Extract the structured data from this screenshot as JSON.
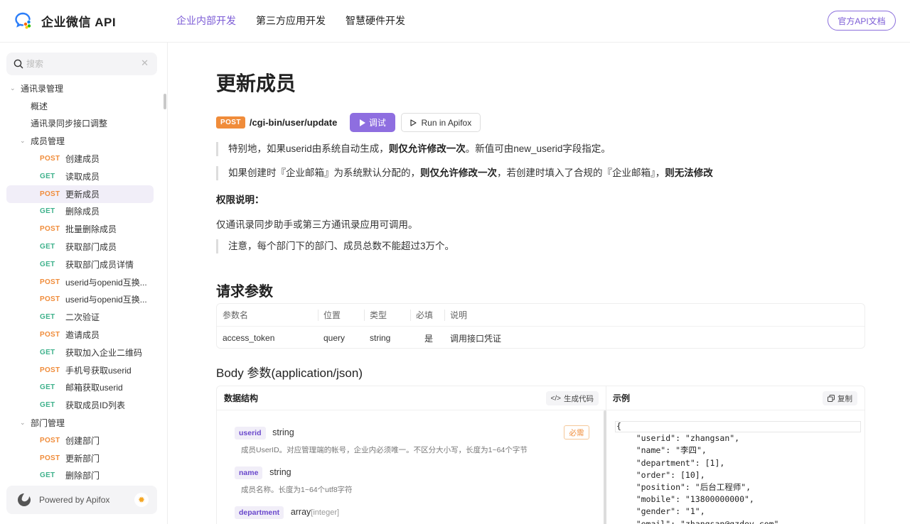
{
  "header": {
    "logo_text": "企业微信 API",
    "nav": [
      "企业内部开发",
      "第三方应用开发",
      "智慧硬件开发"
    ],
    "doc_button": "官方API文档"
  },
  "sidebar": {
    "search_placeholder": "搜索",
    "tree": [
      {
        "kind": "group",
        "label": "通讯录管理",
        "expanded": true
      },
      {
        "kind": "leaf",
        "label": "概述"
      },
      {
        "kind": "leaf",
        "label": "通讯录同步接口调整"
      },
      {
        "kind": "sub",
        "label": "成员管理",
        "expanded": true
      },
      {
        "kind": "api",
        "method": "POST",
        "label": "创建成员"
      },
      {
        "kind": "api",
        "method": "GET",
        "label": "读取成员"
      },
      {
        "kind": "api",
        "method": "POST",
        "label": "更新成员",
        "active": true
      },
      {
        "kind": "api",
        "method": "GET",
        "label": "删除成员"
      },
      {
        "kind": "api",
        "method": "POST",
        "label": "批量删除成员"
      },
      {
        "kind": "api",
        "method": "GET",
        "label": "获取部门成员"
      },
      {
        "kind": "api",
        "method": "GET",
        "label": "获取部门成员详情"
      },
      {
        "kind": "api",
        "method": "POST",
        "label": "userid与openid互换..."
      },
      {
        "kind": "api",
        "method": "POST",
        "label": "userid与openid互换..."
      },
      {
        "kind": "api",
        "method": "GET",
        "label": "二次验证"
      },
      {
        "kind": "api",
        "method": "POST",
        "label": "邀请成员"
      },
      {
        "kind": "api",
        "method": "GET",
        "label": "获取加入企业二维码"
      },
      {
        "kind": "api",
        "method": "POST",
        "label": "手机号获取userid"
      },
      {
        "kind": "api",
        "method": "GET",
        "label": "邮箱获取userid"
      },
      {
        "kind": "api",
        "method": "GET",
        "label": "获取成员ID列表"
      },
      {
        "kind": "sub",
        "label": "部门管理",
        "expanded": true
      },
      {
        "kind": "api",
        "method": "POST",
        "label": "创建部门"
      },
      {
        "kind": "api",
        "method": "POST",
        "label": "更新部门"
      },
      {
        "kind": "api",
        "method": "GET",
        "label": "删除部门"
      }
    ],
    "powered_by": "Powered by Apifox"
  },
  "main": {
    "title": "更新成员",
    "method": "POST",
    "path": "/cgi-bin/user/update",
    "debug_label": "调试",
    "run_label": "Run in Apifox",
    "note1": {
      "a": "特别地，如果userid由系统自动生成，",
      "b": "则仅允许修改一次",
      "c": "。新值可由new_userid字段指定。"
    },
    "note2": {
      "a": "如果创建时『企业邮箱』为系统默认分配的，",
      "b": "则仅允许修改一次",
      "c": "，若创建时填入了合规的『企业邮箱』，",
      "d": "则无法修改"
    },
    "perm_title": "权限说明：",
    "perm_text": "仅通讯录同步助手或第三方通讯录应用可调用。",
    "note3": "注意，每个部门下的部门、成员总数不能超过3万个。",
    "req_title": "请求参数",
    "param_headers": [
      "参数名",
      "位置",
      "类型",
      "必填",
      "说明"
    ],
    "param_rows": [
      [
        "access_token",
        "query",
        "string",
        "是",
        "调用接口凭证"
      ]
    ],
    "body_title": "Body 参数(application/json)",
    "schema_title": "数据结构",
    "gen_code": "生成代码",
    "example_title": "示例",
    "copy_label": "复制",
    "fields": [
      {
        "name": "userid",
        "type": "string",
        "type_sub": "",
        "required": "必需",
        "desc": "成员UserID。对应管理端的帐号，企业内必须唯一。不区分大小写，长度为1~64个字节"
      },
      {
        "name": "name",
        "type": "string",
        "type_sub": "",
        "desc": "成员名称。长度为1~64个utf8字符"
      },
      {
        "name": "department",
        "type": "array",
        "type_sub": "[integer]",
        "desc": ""
      }
    ],
    "example_lines": [
      "{",
      "    \"userid\": \"zhangsan\",",
      "    \"name\": \"李四\",",
      "    \"department\": [1],",
      "    \"order\": [10],",
      "    \"position\": \"后台工程师\",",
      "    \"mobile\": \"13800000000\",",
      "    \"gender\": \"1\",",
      "    \"email\": \"zhangsan@gzdev.com\","
    ]
  }
}
